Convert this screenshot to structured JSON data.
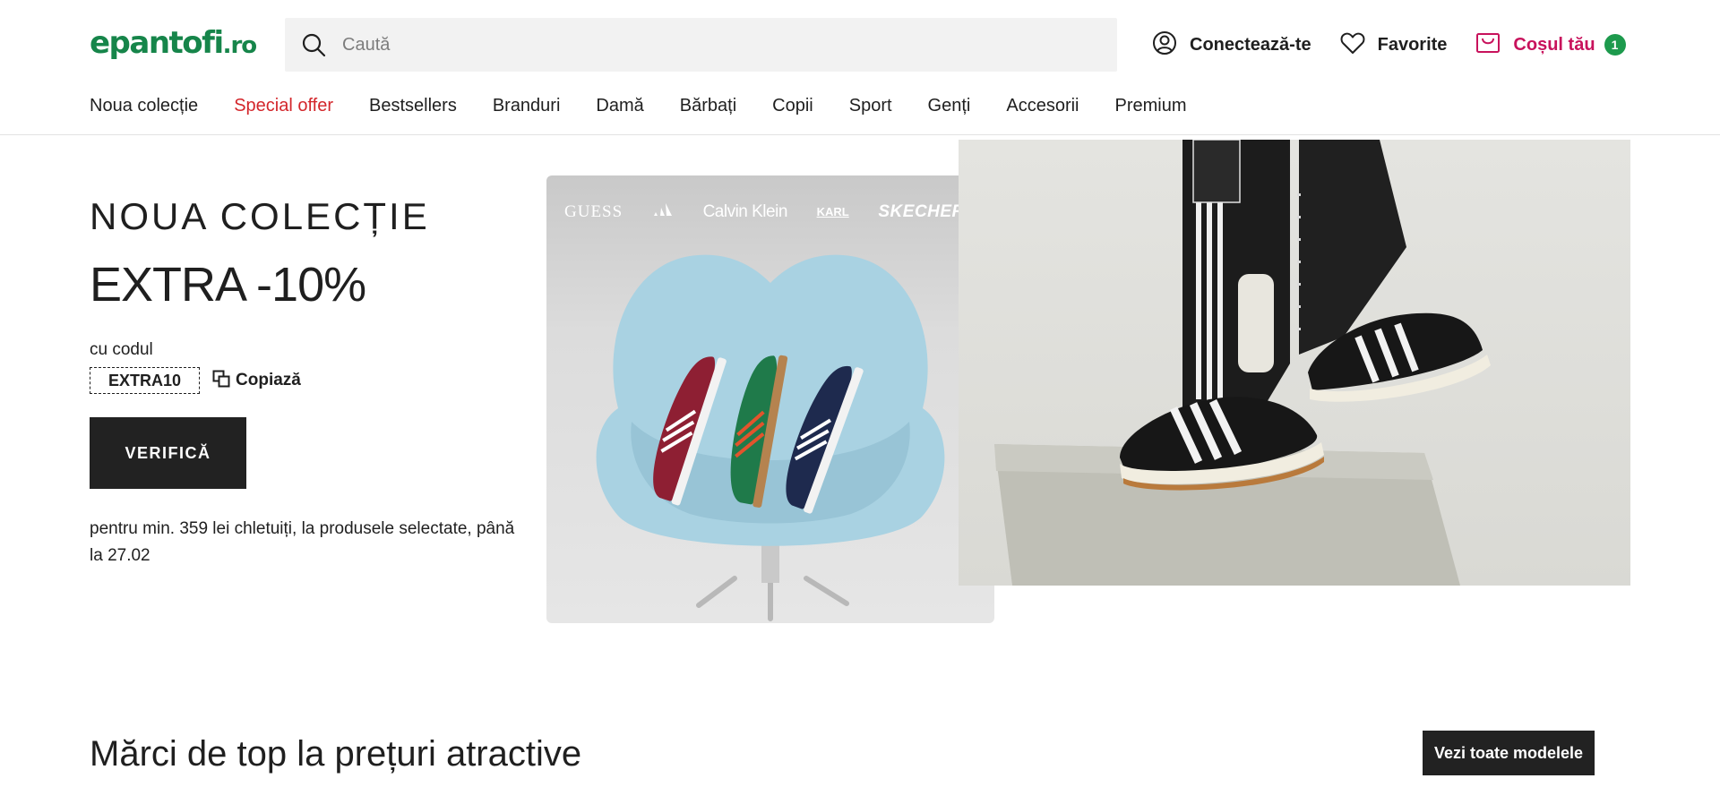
{
  "brand": {
    "logo_main": "epantofi",
    "logo_tld": ".ro"
  },
  "search": {
    "placeholder": "Caută"
  },
  "header_actions": {
    "login": "Conectează-te",
    "favorites": "Favorite",
    "cart": "Coșul tău",
    "cart_count": "1"
  },
  "nav": [
    "Noua colecție",
    "Special offer",
    "Bestsellers",
    "Branduri",
    "Damă",
    "Bărbați",
    "Copii",
    "Sport",
    "Genți",
    "Accesorii",
    "Premium"
  ],
  "hero": {
    "eyebrow": "NOUA COLECȚIE",
    "headline": "EXTRA -10%",
    "code_label": "cu codul",
    "code": "EXTRA10",
    "copy_label": "Copiază",
    "cta": "VERIFICĂ",
    "fine_print": "pentru min. 359 lei chletuiți, la produsele selectate, până la 27.02"
  },
  "promo_brands": [
    "GUESS",
    "Calvin Klein",
    "KARL",
    "SKECHERS"
  ],
  "section": {
    "title": "Mărci de top la prețuri atractive",
    "see_all": "Vezi toate modelele"
  },
  "colors": {
    "logo_green": "#16854a",
    "cart_pink": "#c8125c",
    "badge_green": "#1d9a4d",
    "special_red": "#d3262b",
    "button_dark": "#222222"
  },
  "icons": [
    "search-icon",
    "user-icon",
    "heart-icon",
    "cart-icon",
    "copy-icon",
    "adidas-logo-icon"
  ]
}
